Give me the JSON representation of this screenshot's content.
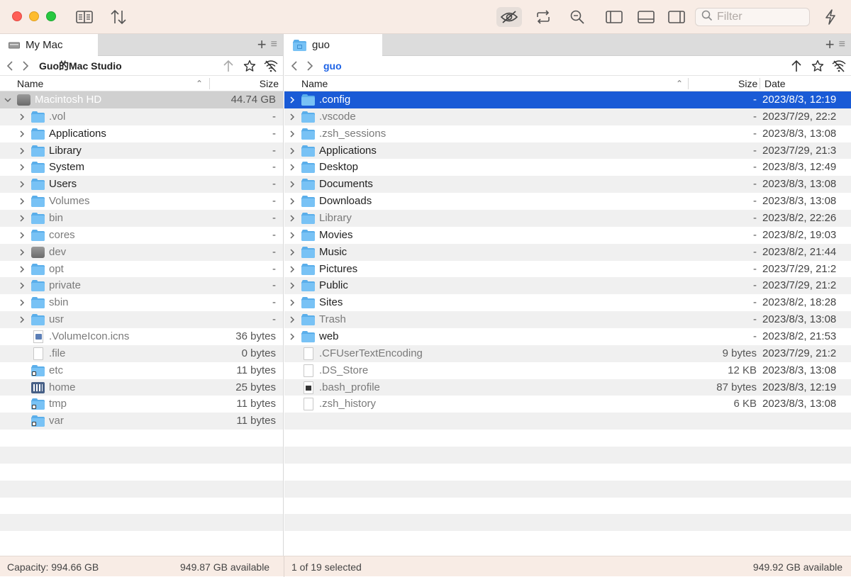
{
  "toolbar": {
    "filter_placeholder": "Filter",
    "icons": [
      "reader-icon",
      "sort-arrows-icon",
      "hidden-files-eye-icon",
      "sync-icon",
      "zoom-icon",
      "left-sidebar-icon",
      "bottom-panel-icon",
      "right-sidebar-icon",
      "search-icon",
      "lightning-icon"
    ]
  },
  "left": {
    "tab_label": "My Mac",
    "path_label": "Guo的Mac Studio",
    "col_name": "Name",
    "col_size": "Size",
    "rows": [
      {
        "name": "Macintosh HD",
        "size": "44.74 GB",
        "kind": "disk",
        "expand": true,
        "volume": true
      },
      {
        "name": ".vol",
        "size": "-",
        "kind": "folder",
        "expand": true,
        "dim": true
      },
      {
        "name": "Applications",
        "size": "-",
        "kind": "folder",
        "expand": true
      },
      {
        "name": "Library",
        "size": "-",
        "kind": "folder",
        "expand": true
      },
      {
        "name": "System",
        "size": "-",
        "kind": "folder",
        "expand": true
      },
      {
        "name": "Users",
        "size": "-",
        "kind": "folder",
        "expand": true
      },
      {
        "name": "Volumes",
        "size": "-",
        "kind": "folder",
        "expand": true,
        "dim": true
      },
      {
        "name": "bin",
        "size": "-",
        "kind": "folder",
        "expand": true,
        "dim": true
      },
      {
        "name": "cores",
        "size": "-",
        "kind": "folder",
        "expand": true,
        "dim": true
      },
      {
        "name": "dev",
        "size": "-",
        "kind": "disk",
        "expand": true,
        "dim": true
      },
      {
        "name": "opt",
        "size": "-",
        "kind": "folder",
        "expand": true,
        "dim": true
      },
      {
        "name": "private",
        "size": "-",
        "kind": "folder",
        "expand": true,
        "dim": true
      },
      {
        "name": "sbin",
        "size": "-",
        "kind": "folder",
        "expand": true,
        "dim": true
      },
      {
        "name": "usr",
        "size": "-",
        "kind": "folder",
        "expand": true,
        "dim": true
      },
      {
        "name": ".VolumeIcon.icns",
        "size": "36 bytes",
        "kind": "icns",
        "dim": true
      },
      {
        "name": ".file",
        "size": "0 bytes",
        "kind": "file",
        "dim": true
      },
      {
        "name": "etc",
        "size": "11 bytes",
        "kind": "alias",
        "dim": true
      },
      {
        "name": "home",
        "size": "25 bytes",
        "kind": "home",
        "dim": true
      },
      {
        "name": "tmp",
        "size": "11 bytes",
        "kind": "alias",
        "dim": true
      },
      {
        "name": "var",
        "size": "11 bytes",
        "kind": "alias",
        "dim": true
      }
    ],
    "status_capacity": "Capacity: 994.66 GB",
    "status_available": "949.87 GB available"
  },
  "right": {
    "tab_label": "guo",
    "path_label": "guo",
    "col_name": "Name",
    "col_size": "Size",
    "col_date": "Date",
    "rows": [
      {
        "name": ".config",
        "size": "-",
        "date": "2023/8/3, 12:19",
        "kind": "folder",
        "expand": true,
        "selected": true,
        "dim": true
      },
      {
        "name": ".vscode",
        "size": "-",
        "date": "2023/7/29, 22:2",
        "kind": "folder",
        "expand": true,
        "dim": true
      },
      {
        "name": ".zsh_sessions",
        "size": "-",
        "date": "2023/8/3, 13:08",
        "kind": "folder",
        "expand": true,
        "dim": true
      },
      {
        "name": "Applications",
        "size": "-",
        "date": "2023/7/29, 21:3",
        "kind": "folder",
        "expand": true
      },
      {
        "name": "Desktop",
        "size": "-",
        "date": "2023/8/3, 12:49",
        "kind": "folder",
        "expand": true
      },
      {
        "name": "Documents",
        "size": "-",
        "date": "2023/8/3, 13:08",
        "kind": "folder",
        "expand": true
      },
      {
        "name": "Downloads",
        "size": "-",
        "date": "2023/8/3, 13:08",
        "kind": "folder",
        "expand": true
      },
      {
        "name": "Library",
        "size": "-",
        "date": "2023/8/2, 22:26",
        "kind": "folder",
        "expand": true,
        "dim": true
      },
      {
        "name": "Movies",
        "size": "-",
        "date": "2023/8/2, 19:03",
        "kind": "folder",
        "expand": true
      },
      {
        "name": "Music",
        "size": "-",
        "date": "2023/8/2, 21:44",
        "kind": "folder",
        "expand": true
      },
      {
        "name": "Pictures",
        "size": "-",
        "date": "2023/7/29, 21:2",
        "kind": "folder",
        "expand": true
      },
      {
        "name": "Public",
        "size": "-",
        "date": "2023/7/29, 21:2",
        "kind": "folder",
        "expand": true
      },
      {
        "name": "Sites",
        "size": "-",
        "date": "2023/8/2, 18:28",
        "kind": "folder",
        "expand": true
      },
      {
        "name": "Trash",
        "size": "-",
        "date": "2023/8/3, 13:08",
        "kind": "folder",
        "expand": true,
        "dim": true
      },
      {
        "name": "web",
        "size": "-",
        "date": "2023/8/2, 21:53",
        "kind": "folder",
        "expand": true
      },
      {
        "name": ".CFUserTextEncoding",
        "size": "9 bytes",
        "date": "2023/7/29, 21:2",
        "kind": "file",
        "dim": true
      },
      {
        "name": ".DS_Store",
        "size": "12 KB",
        "date": "2023/8/3, 13:08",
        "kind": "file",
        "dim": true
      },
      {
        "name": ".bash_profile",
        "size": "87 bytes",
        "date": "2023/8/3, 12:19",
        "kind": "darkfile",
        "dim": true
      },
      {
        "name": ".zsh_history",
        "size": "6 KB",
        "date": "2023/8/3, 13:08",
        "kind": "file",
        "dim": true
      }
    ],
    "status_selected": "1 of 19 selected",
    "status_available": "949.92 GB available"
  }
}
